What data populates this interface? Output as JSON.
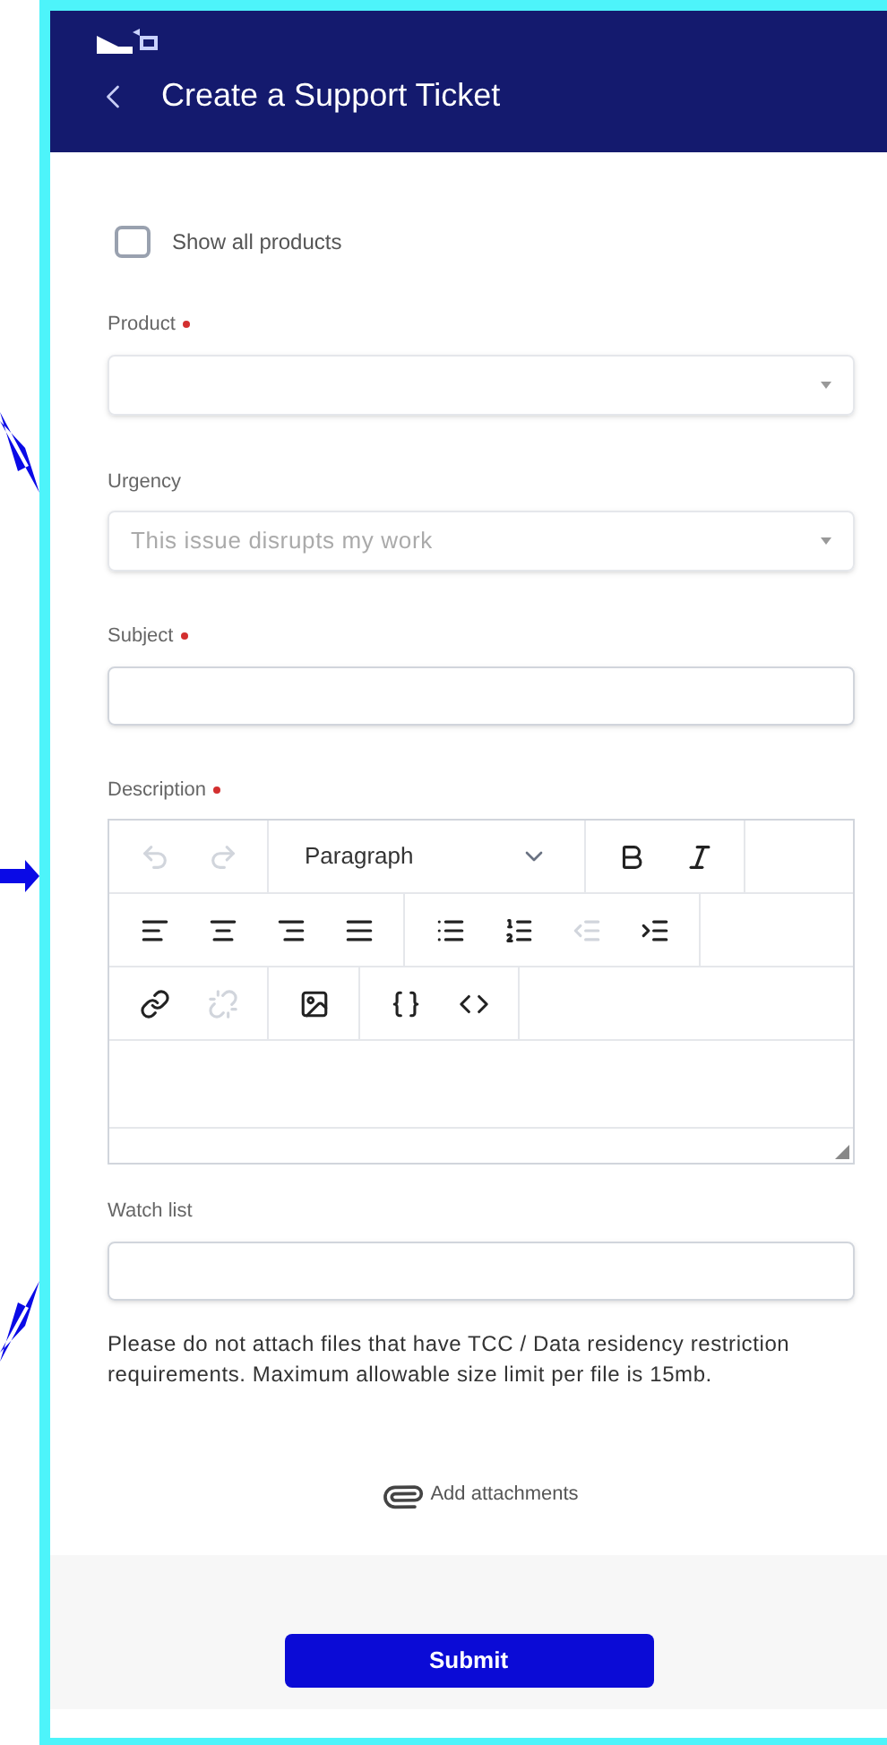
{
  "header": {
    "title": "Create a Support Ticket"
  },
  "show_all_products": {
    "label": "Show all products",
    "checked": false
  },
  "fields": [
    {
      "kind": "select",
      "label": "Product",
      "required": true
    },
    {
      "kind": "select",
      "label": "Urgency",
      "required": false,
      "value": "This issue disrupts my work"
    },
    {
      "kind": "text",
      "label": "Subject",
      "required": true
    },
    {
      "kind": "editor",
      "label": "Description",
      "required": true
    },
    {
      "kind": "text",
      "label": "Watch list",
      "required": false
    }
  ],
  "editor": {
    "toolbar": [
      [
        [
          {
            "kind": "undo",
            "disabled": true
          },
          {
            "kind": "redo",
            "disabled": true
          }
        ],
        [
          {
            "kind": "format",
            "label": "Paragraph",
            "disabled": false
          }
        ],
        [
          {
            "kind": "bold",
            "disabled": false
          },
          {
            "kind": "italic",
            "disabled": false
          }
        ]
      ],
      [
        [
          {
            "kind": "align-left",
            "disabled": false
          },
          {
            "kind": "align-center",
            "disabled": false
          },
          {
            "kind": "align-right",
            "disabled": false
          },
          {
            "kind": "align-justify",
            "disabled": false
          }
        ],
        [
          {
            "kind": "bullet-list",
            "disabled": false
          },
          {
            "kind": "numbered-list",
            "disabled": false
          },
          {
            "kind": "outdent",
            "disabled": true
          },
          {
            "kind": "indent",
            "disabled": false
          }
        ]
      ],
      [
        [
          {
            "kind": "link",
            "disabled": false
          },
          {
            "kind": "unlink",
            "disabled": true
          }
        ],
        [
          {
            "kind": "image",
            "disabled": false
          }
        ],
        [
          {
            "kind": "braces",
            "disabled": false
          },
          {
            "kind": "code",
            "disabled": false
          }
        ]
      ]
    ]
  },
  "note": "Please do not attach files that have TCC / Data residency restriction requirements. Maximum allowable size limit per file is 15mb.",
  "attach": {
    "label": "Add attachments"
  },
  "submit": {
    "label": "Submit"
  }
}
